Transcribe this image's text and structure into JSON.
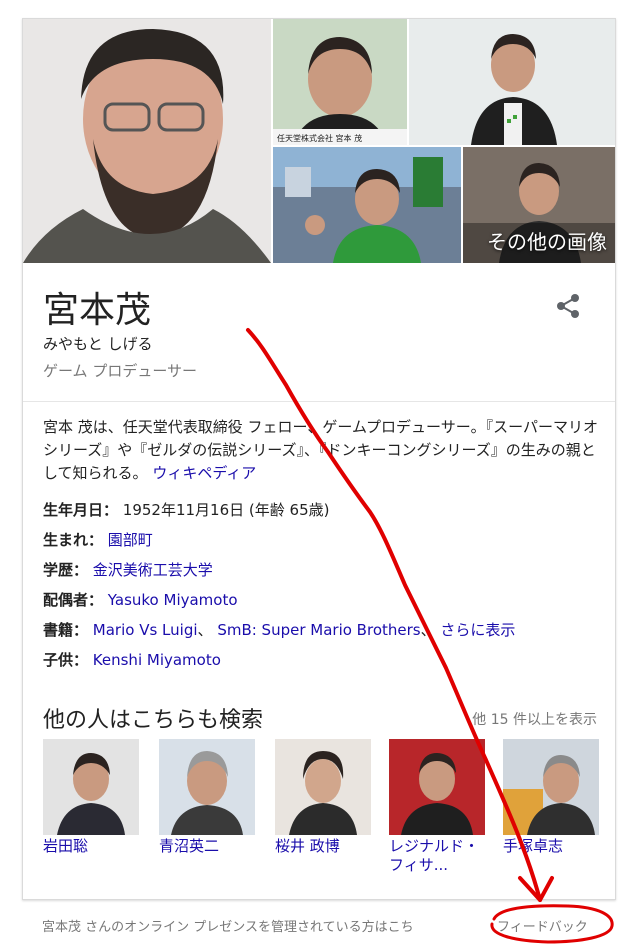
{
  "images": {
    "more_images_label": "その他の画像",
    "main_alt": "main photo",
    "tiles": [
      "photo-2",
      "photo-3",
      "photo-4",
      "photo-5"
    ],
    "tile1_caption": "任天堂株式会社 宮本 茂"
  },
  "header": {
    "name": "宮本茂",
    "reading": "みやもと しげる",
    "role": "ゲーム プロデューサー",
    "share_icon": "share-icon"
  },
  "description": {
    "text": "宮本 茂は、任天堂代表取締役 フェロー、ゲームプロデューサー。『スーパーマリオシリーズ』や『ゼルダの伝説シリーズ』、『ドンキーコングシリーズ』の生みの親として知られる。",
    "source_link": "ウィキペディア"
  },
  "facts": {
    "birth_label": "生年月日：",
    "birth_value": "1952年11月16日 (年齢 65歳)",
    "born_label": "生まれ：",
    "born_value": "園部町",
    "education_label": "学歴：",
    "education_value": "金沢美術工芸大学",
    "spouse_label": "配偶者：",
    "spouse_value": "Yasuko Miyamoto",
    "books_label": "書籍：",
    "book1": "Mario Vs Luigi",
    "sep1": "、",
    "book2": "SmB: Super Mario Brothers",
    "sep2": "、",
    "books_more": "さらに表示",
    "children_label": "子供：",
    "children_value": "Kenshi Miyamoto"
  },
  "related": {
    "title": "他の人はこちらも検索",
    "see_more": "他 15 件以上を表示",
    "people": [
      "岩田聡",
      "青沼英二",
      "桜井 政博",
      "レジナルド・フィサ...",
      "手塚卓志"
    ]
  },
  "footer": {
    "text": "宮本茂 さんのオンライン プレゼンスを管理されている方はこち",
    "feedback": "フィードバック"
  },
  "colors": {
    "link": "#1a0dab",
    "annotation": "#e00000",
    "muted": "#777777"
  }
}
